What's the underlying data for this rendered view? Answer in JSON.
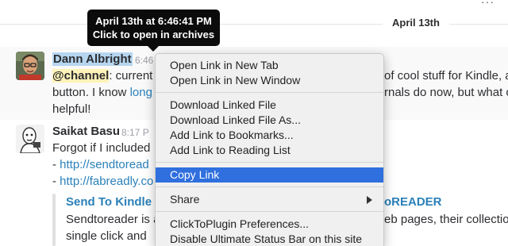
{
  "date_divider": "April 13th",
  "tooltip": {
    "line1": "April 13th at 6:46:41 PM",
    "line2": "Click to open in archives"
  },
  "message1": {
    "sender": "Dann Albright",
    "time": "6:46",
    "mention": "@channel",
    "line1_after_mention": ": current",
    "line1_right": "of cool stuff for Kindle, a",
    "line2_start": "button. I know ",
    "line2_link": "long",
    "line2_right": "rnals do now, but what o",
    "line3": "helpful!"
  },
  "message2": {
    "sender": "Saikat Basu",
    "time": "8:17 P",
    "line1": "Forgot if I included",
    "line2_prefix": "- ",
    "line2_link": "http://sendtoread",
    "line3_prefix": "- ",
    "line3_link": "http://fabreadly.co",
    "attachment_title_left": "Send To Kindle",
    "attachment_title_right": "oREADER",
    "attachment_line1_left": "Sendtoreader is a",
    "attachment_line1_right": "eb pages, their collection",
    "attachment_line2": "single click and"
  },
  "context_menu": {
    "groups": [
      [
        "Open Link in New Tab",
        "Open Link in New Window"
      ],
      [
        "Download Linked File",
        "Download Linked File As...",
        "Add Link to Bookmarks...",
        "Add Link to Reading List"
      ],
      [
        "Copy Link"
      ],
      [
        "Share"
      ],
      [
        "ClickToPlugin Preferences...",
        "Disable Ultimate Status Bar on this site"
      ]
    ],
    "selected_item": "Copy Link"
  },
  "colors": {
    "selection": "#2f6fde",
    "link": "#2a80b9",
    "mention_bg": "#fff3b8",
    "sender_highlight": "#b6d6f0"
  }
}
